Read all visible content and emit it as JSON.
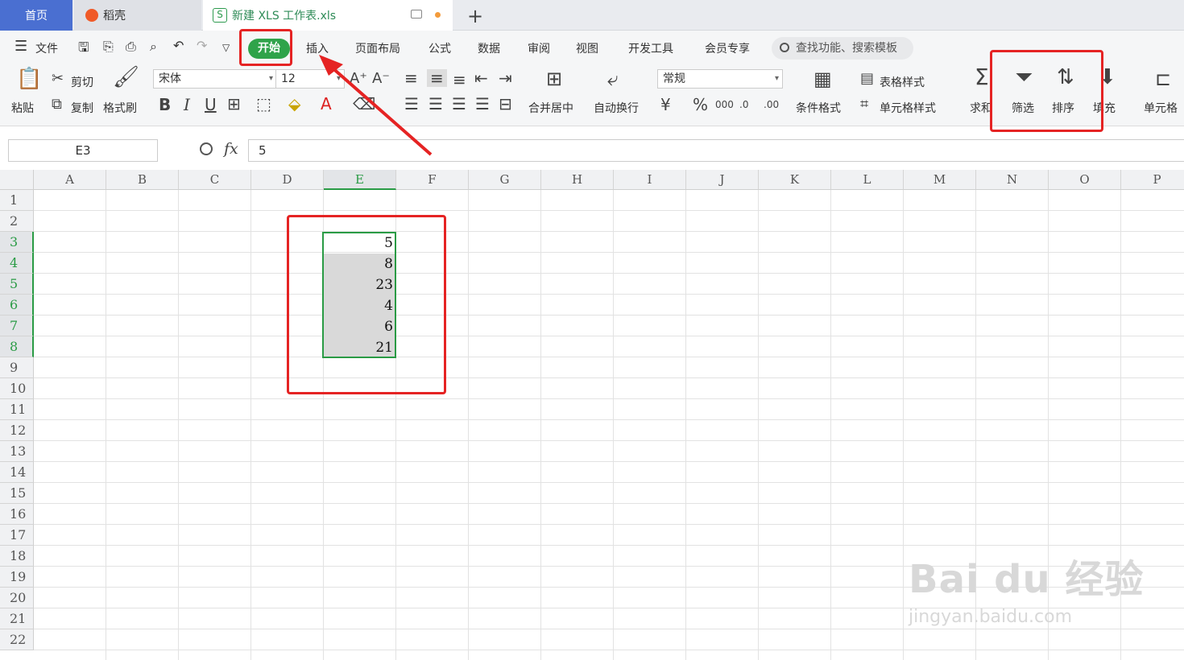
{
  "tabs": {
    "home": "首页",
    "daoke": "稻壳",
    "file": "新建 XLS 工作表.xls",
    "file_icon": "S"
  },
  "menu": {
    "file": "文件",
    "items": [
      "开始",
      "插入",
      "页面布局",
      "公式",
      "数据",
      "审阅",
      "视图",
      "开发工具",
      "会员专享"
    ],
    "search_placeholder": "查找功能、搜索模板"
  },
  "ribbon": {
    "paste": "粘贴",
    "cut": "剪切",
    "copy": "复制",
    "format_painter": "格式刷",
    "font_name": "宋体",
    "font_size": "12",
    "merge_center": "合并居中",
    "wrap_text": "自动换行",
    "number_format": "常规",
    "conditional_format": "条件格式",
    "table_style": "表格样式",
    "cell_style": "单元格样式",
    "sum": "求和",
    "filter": "筛选",
    "sort": "排序",
    "fill": "填充",
    "cell": "单元格"
  },
  "formula": {
    "name_box": "E3",
    "fx": "fx",
    "value": "5"
  },
  "columns": [
    "A",
    "B",
    "C",
    "D",
    "E",
    "F",
    "G",
    "H",
    "I",
    "J",
    "K",
    "L",
    "M",
    "N",
    "O",
    "P"
  ],
  "rows": [
    "1",
    "2",
    "3",
    "4",
    "5",
    "6",
    "7",
    "8",
    "9",
    "10",
    "11",
    "12",
    "13",
    "14",
    "15",
    "16",
    "17",
    "18",
    "19",
    "20",
    "21",
    "22"
  ],
  "cells_E": [
    "5",
    "8",
    "23",
    "4",
    "6",
    "21"
  ],
  "watermark": {
    "main": "Bai du 经验",
    "sub": "jingyan.baidu.com"
  },
  "colors": {
    "accent": "#2a9b45",
    "annotation": "#e52323"
  }
}
